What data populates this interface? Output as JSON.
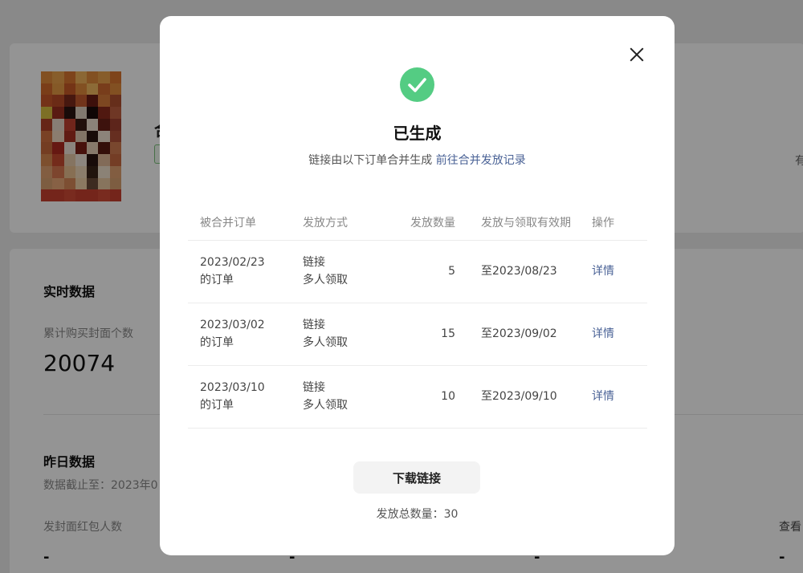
{
  "background": {
    "product_title_fragment": "合",
    "right_fragment": "有",
    "realtime_section_title": "实时数据",
    "cumulative_label": "累计购买封面个数",
    "cumulative_value": "20074",
    "yesterday_section_title": "昨日数据",
    "data_cutoff_text": "数据截止至：2023年0",
    "recipients_label": "发封面红包人数",
    "view_fragment": "查看",
    "empty_value": "-"
  },
  "modal": {
    "title": "已生成",
    "subtitle": "链接由以下订单合并生成",
    "records_link": "前往合并发放记录",
    "table": {
      "headers": [
        "被合并订单",
        "发放方式",
        "发放数量",
        "发放与领取有效期",
        "操作"
      ],
      "rows": [
        {
          "order_date": "2023/02/23",
          "order_suffix": "的订单",
          "method_line1": "链接",
          "method_line2": "多人领取",
          "quantity": "5",
          "validity": "至2023/08/23",
          "action": "详情"
        },
        {
          "order_date": "2023/03/02",
          "order_suffix": "的订单",
          "method_line1": "链接",
          "method_line2": "多人领取",
          "quantity": "15",
          "validity": "至2023/09/02",
          "action": "详情"
        },
        {
          "order_date": "2023/03/10",
          "order_suffix": "的订单",
          "method_line1": "链接",
          "method_line2": "多人领取",
          "quantity": "10",
          "validity": "至2023/09/10",
          "action": "详情"
        }
      ]
    },
    "download_button": "下载链接",
    "total_quantity": "发放总数量：30"
  },
  "icons": {
    "close": "close-icon",
    "success": "check-circle-icon"
  },
  "colors": {
    "success": "#2fc169",
    "link": "#4a6296",
    "overlay": "rgba(0,0,0,0.42)"
  }
}
